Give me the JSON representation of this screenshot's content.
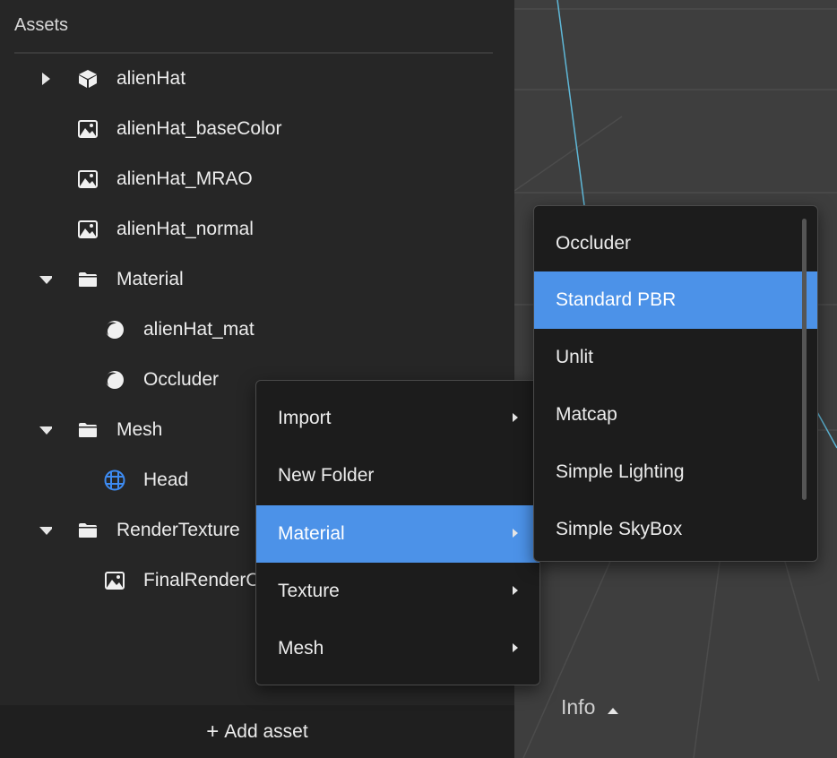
{
  "assets_panel": {
    "title": "Assets",
    "items": [
      {
        "label": "alienHat",
        "icon": "cube-icon",
        "arrow": "collapsed"
      },
      {
        "label": "alienHat_baseColor",
        "icon": "image-icon"
      },
      {
        "label": "alienHat_MRAO",
        "icon": "image-icon"
      },
      {
        "label": "alienHat_normal",
        "icon": "image-icon"
      },
      {
        "label": "Material",
        "icon": "folder-icon",
        "arrow": "expanded"
      },
      {
        "label": "alienHat_mat",
        "icon": "material-icon"
      },
      {
        "label": "Occluder",
        "icon": "material-icon"
      },
      {
        "label": "Mesh",
        "icon": "folder-icon",
        "arrow": "expanded"
      },
      {
        "label": "Head",
        "icon": "mesh-grid-icon"
      },
      {
        "label": "RenderTexture",
        "icon": "folder-icon",
        "arrow": "expanded"
      },
      {
        "label": "FinalRenderOutput",
        "icon": "image-icon"
      }
    ],
    "add_asset_label": "Add asset",
    "add_asset_icon": "plus-icon"
  },
  "context_menu": {
    "items": [
      {
        "label": "Import",
        "has_submenu": true
      },
      {
        "label": "New Folder",
        "has_submenu": false
      },
      {
        "label": "Material",
        "has_submenu": true,
        "active": true
      },
      {
        "label": "Texture",
        "has_submenu": true
      },
      {
        "label": "Mesh",
        "has_submenu": true
      }
    ]
  },
  "submenu": {
    "items": [
      {
        "label": "Occluder"
      },
      {
        "label": "Standard PBR",
        "active": true
      },
      {
        "label": "Unlit"
      },
      {
        "label": "Matcap"
      },
      {
        "label": "Simple Lighting"
      },
      {
        "label": "Simple SkyBox"
      }
    ]
  },
  "info_panel": {
    "label": "Info",
    "icon": "caret-up-icon"
  },
  "colors": {
    "accent": "#4c92e8",
    "panel_bg": "#262626",
    "menu_bg": "#1c1c1c",
    "viewport_bg": "#3e3e3e",
    "mesh_icon": "#3d8bf2",
    "gizmo_line": "#5fb8d8"
  }
}
